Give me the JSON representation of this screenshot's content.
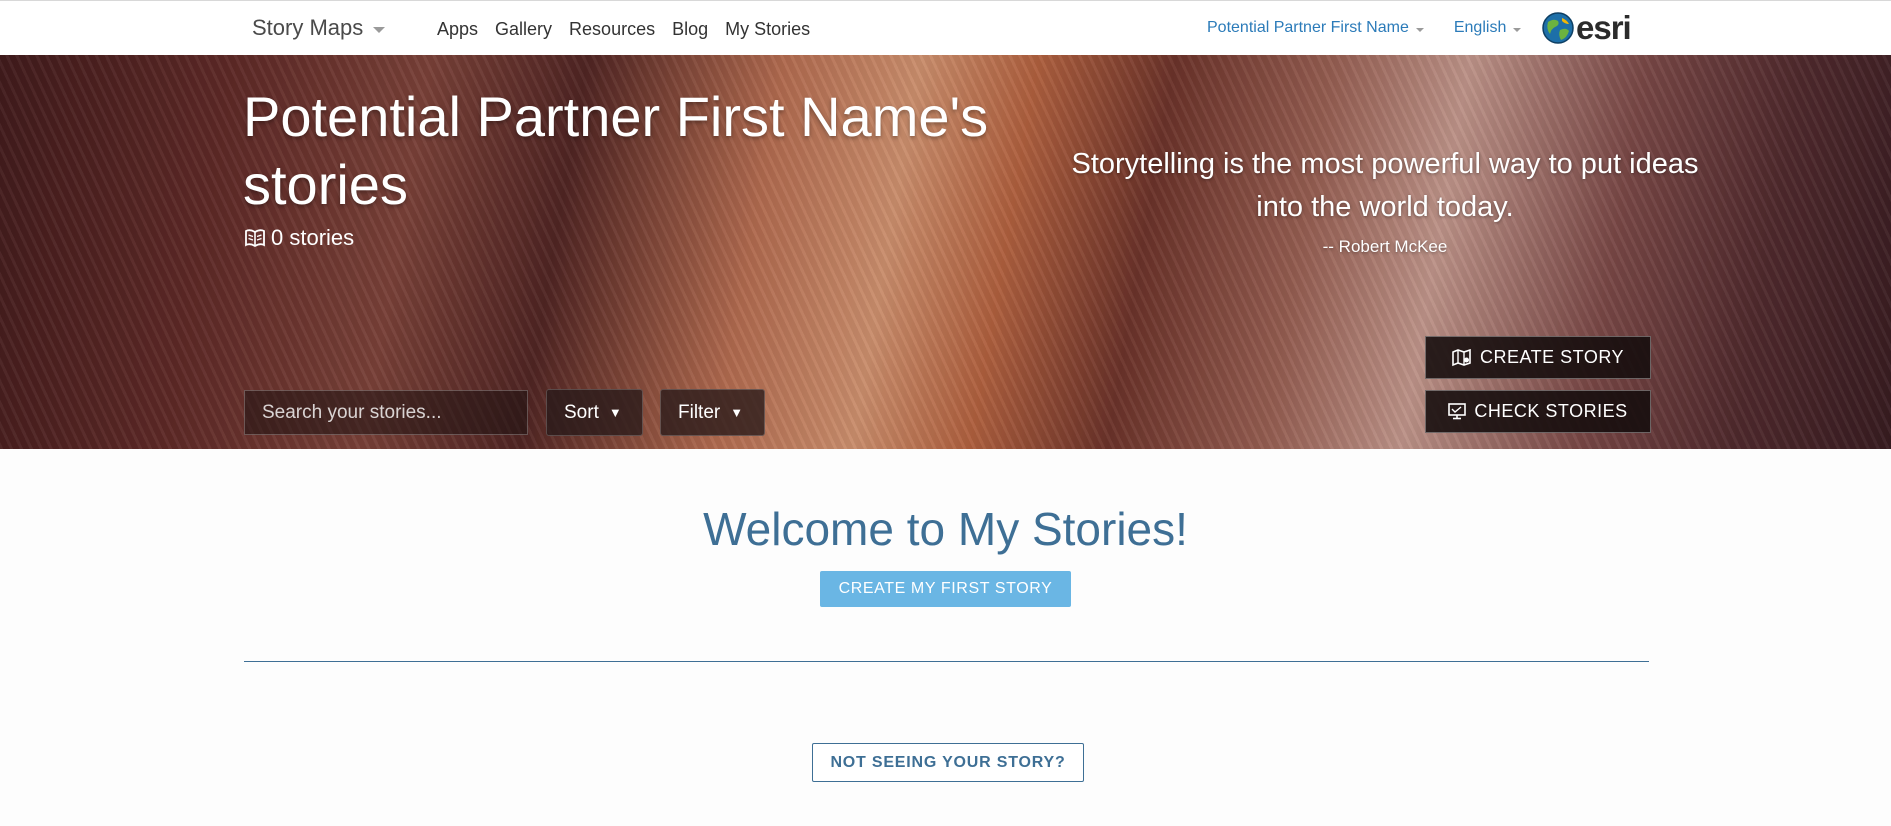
{
  "navbar": {
    "brand": "Story Maps",
    "links": [
      "Apps",
      "Gallery",
      "Resources",
      "Blog",
      "My Stories"
    ],
    "user_menu": "Potential Partner First Name",
    "language": "English",
    "logo_text": "esri"
  },
  "hero": {
    "title": "Potential Partner First Name's stories",
    "story_count": "0 stories",
    "quote": "Storytelling is the most powerful way to put ideas into the world today.",
    "quote_author": "-- Robert McKee",
    "search_placeholder": "Search your stories...",
    "sort_label": "Sort",
    "filter_label": "Filter",
    "create_story_label": "CREATE STORY",
    "check_stories_label": "CHECK STORIES"
  },
  "main": {
    "welcome": "Welcome to My Stories!",
    "first_story_label": "CREATE MY FIRST STORY",
    "not_seeing_label": "NOT SEEING YOUR STORY?"
  },
  "colors": {
    "accent": "#3e6f95",
    "link": "#2b7bb9",
    "primary_button": "#6ab6e4"
  }
}
